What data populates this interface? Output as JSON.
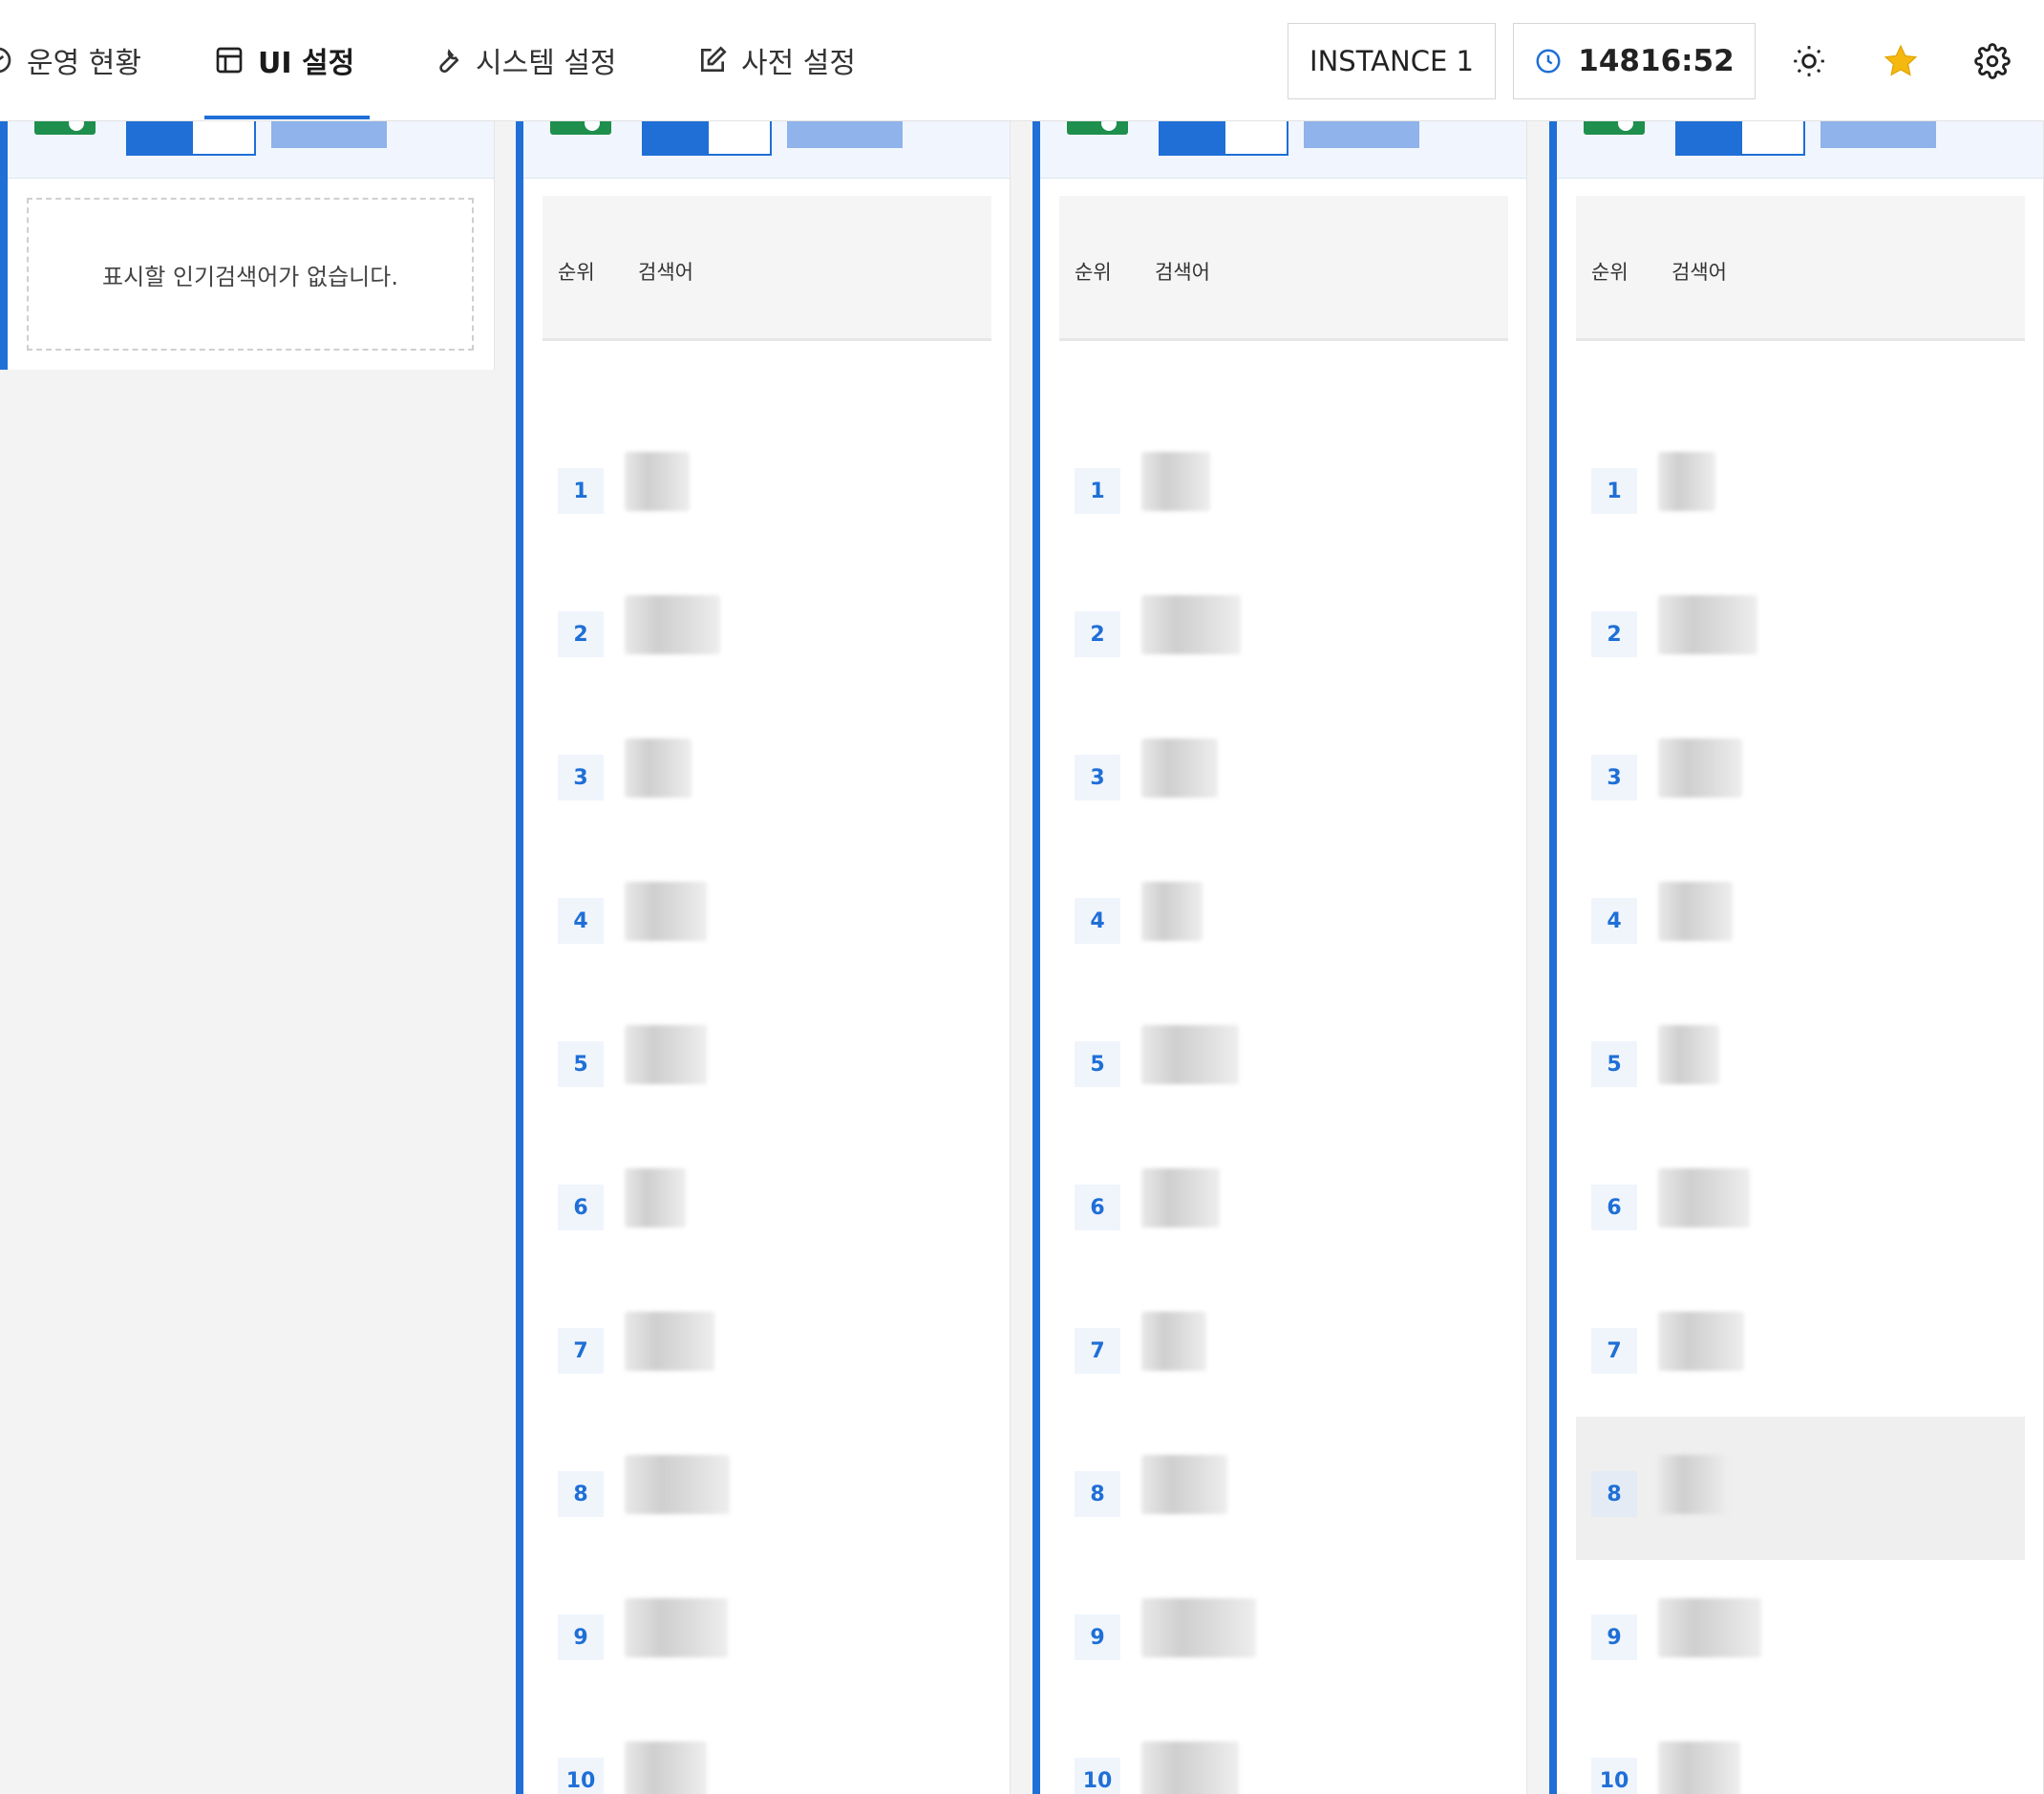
{
  "nav": {
    "items": [
      {
        "label": "운영 현황",
        "icon": "gauge-icon"
      },
      {
        "label": "UI 설정",
        "icon": "layout-icon",
        "active": true
      },
      {
        "label": "시스템 설정",
        "icon": "wrench-icon"
      },
      {
        "label": "사전 설정",
        "icon": "edit-icon"
      }
    ],
    "instance": "INSTANCE 1",
    "timer": "14816:52",
    "icons": [
      "sun-icon",
      "star-icon",
      "gear-icon"
    ],
    "star_color": "#f5b80f",
    "accent_color": "#1f6fd6"
  },
  "columns": {
    "col1": {
      "empty_message": "표시할 인기검색어가 없습니다."
    },
    "col2": {
      "headers": {
        "rank": "순위",
        "keyword": "검색어"
      },
      "ranks": [
        "1",
        "2",
        "3",
        "4",
        "5",
        "6",
        "7",
        "8",
        "9",
        "10"
      ]
    },
    "col3": {
      "headers": {
        "rank": "순위",
        "keyword": "검색어"
      },
      "ranks": [
        "1",
        "2",
        "3",
        "4",
        "5",
        "6",
        "7",
        "8",
        "9",
        "10"
      ]
    },
    "col4": {
      "headers": {
        "rank": "순위",
        "keyword": "검색어"
      },
      "ranks": [
        "1",
        "2",
        "3",
        "4",
        "5",
        "6",
        "7",
        "8",
        "9",
        "10"
      ],
      "highlighted_rank": "8"
    }
  }
}
